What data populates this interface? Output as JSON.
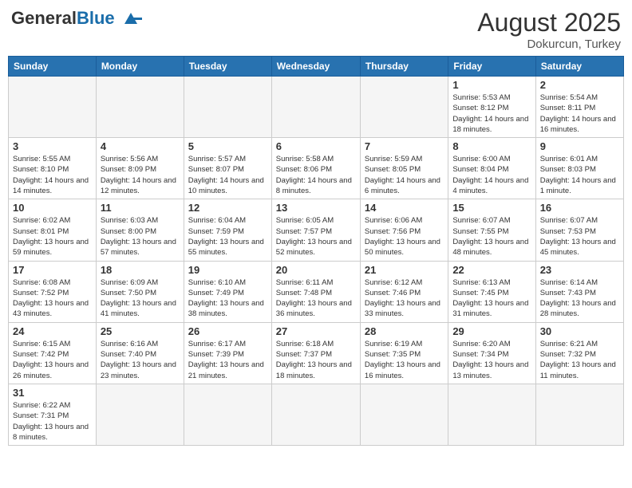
{
  "header": {
    "logo_general": "General",
    "logo_blue": "Blue",
    "month_year": "August 2025",
    "location": "Dokurcun, Turkey"
  },
  "weekdays": [
    "Sunday",
    "Monday",
    "Tuesday",
    "Wednesday",
    "Thursday",
    "Friday",
    "Saturday"
  ],
  "weeks": [
    [
      {
        "day": "",
        "info": ""
      },
      {
        "day": "",
        "info": ""
      },
      {
        "day": "",
        "info": ""
      },
      {
        "day": "",
        "info": ""
      },
      {
        "day": "",
        "info": ""
      },
      {
        "day": "1",
        "info": "Sunrise: 5:53 AM\nSunset: 8:12 PM\nDaylight: 14 hours and 18 minutes."
      },
      {
        "day": "2",
        "info": "Sunrise: 5:54 AM\nSunset: 8:11 PM\nDaylight: 14 hours and 16 minutes."
      }
    ],
    [
      {
        "day": "3",
        "info": "Sunrise: 5:55 AM\nSunset: 8:10 PM\nDaylight: 14 hours and 14 minutes."
      },
      {
        "day": "4",
        "info": "Sunrise: 5:56 AM\nSunset: 8:09 PM\nDaylight: 14 hours and 12 minutes."
      },
      {
        "day": "5",
        "info": "Sunrise: 5:57 AM\nSunset: 8:07 PM\nDaylight: 14 hours and 10 minutes."
      },
      {
        "day": "6",
        "info": "Sunrise: 5:58 AM\nSunset: 8:06 PM\nDaylight: 14 hours and 8 minutes."
      },
      {
        "day": "7",
        "info": "Sunrise: 5:59 AM\nSunset: 8:05 PM\nDaylight: 14 hours and 6 minutes."
      },
      {
        "day": "8",
        "info": "Sunrise: 6:00 AM\nSunset: 8:04 PM\nDaylight: 14 hours and 4 minutes."
      },
      {
        "day": "9",
        "info": "Sunrise: 6:01 AM\nSunset: 8:03 PM\nDaylight: 14 hours and 1 minute."
      }
    ],
    [
      {
        "day": "10",
        "info": "Sunrise: 6:02 AM\nSunset: 8:01 PM\nDaylight: 13 hours and 59 minutes."
      },
      {
        "day": "11",
        "info": "Sunrise: 6:03 AM\nSunset: 8:00 PM\nDaylight: 13 hours and 57 minutes."
      },
      {
        "day": "12",
        "info": "Sunrise: 6:04 AM\nSunset: 7:59 PM\nDaylight: 13 hours and 55 minutes."
      },
      {
        "day": "13",
        "info": "Sunrise: 6:05 AM\nSunset: 7:57 PM\nDaylight: 13 hours and 52 minutes."
      },
      {
        "day": "14",
        "info": "Sunrise: 6:06 AM\nSunset: 7:56 PM\nDaylight: 13 hours and 50 minutes."
      },
      {
        "day": "15",
        "info": "Sunrise: 6:07 AM\nSunset: 7:55 PM\nDaylight: 13 hours and 48 minutes."
      },
      {
        "day": "16",
        "info": "Sunrise: 6:07 AM\nSunset: 7:53 PM\nDaylight: 13 hours and 45 minutes."
      }
    ],
    [
      {
        "day": "17",
        "info": "Sunrise: 6:08 AM\nSunset: 7:52 PM\nDaylight: 13 hours and 43 minutes."
      },
      {
        "day": "18",
        "info": "Sunrise: 6:09 AM\nSunset: 7:50 PM\nDaylight: 13 hours and 41 minutes."
      },
      {
        "day": "19",
        "info": "Sunrise: 6:10 AM\nSunset: 7:49 PM\nDaylight: 13 hours and 38 minutes."
      },
      {
        "day": "20",
        "info": "Sunrise: 6:11 AM\nSunset: 7:48 PM\nDaylight: 13 hours and 36 minutes."
      },
      {
        "day": "21",
        "info": "Sunrise: 6:12 AM\nSunset: 7:46 PM\nDaylight: 13 hours and 33 minutes."
      },
      {
        "day": "22",
        "info": "Sunrise: 6:13 AM\nSunset: 7:45 PM\nDaylight: 13 hours and 31 minutes."
      },
      {
        "day": "23",
        "info": "Sunrise: 6:14 AM\nSunset: 7:43 PM\nDaylight: 13 hours and 28 minutes."
      }
    ],
    [
      {
        "day": "24",
        "info": "Sunrise: 6:15 AM\nSunset: 7:42 PM\nDaylight: 13 hours and 26 minutes."
      },
      {
        "day": "25",
        "info": "Sunrise: 6:16 AM\nSunset: 7:40 PM\nDaylight: 13 hours and 23 minutes."
      },
      {
        "day": "26",
        "info": "Sunrise: 6:17 AM\nSunset: 7:39 PM\nDaylight: 13 hours and 21 minutes."
      },
      {
        "day": "27",
        "info": "Sunrise: 6:18 AM\nSunset: 7:37 PM\nDaylight: 13 hours and 18 minutes."
      },
      {
        "day": "28",
        "info": "Sunrise: 6:19 AM\nSunset: 7:35 PM\nDaylight: 13 hours and 16 minutes."
      },
      {
        "day": "29",
        "info": "Sunrise: 6:20 AM\nSunset: 7:34 PM\nDaylight: 13 hours and 13 minutes."
      },
      {
        "day": "30",
        "info": "Sunrise: 6:21 AM\nSunset: 7:32 PM\nDaylight: 13 hours and 11 minutes."
      }
    ],
    [
      {
        "day": "31",
        "info": "Sunrise: 6:22 AM\nSunset: 7:31 PM\nDaylight: 13 hours and 8 minutes."
      },
      {
        "day": "",
        "info": ""
      },
      {
        "day": "",
        "info": ""
      },
      {
        "day": "",
        "info": ""
      },
      {
        "day": "",
        "info": ""
      },
      {
        "day": "",
        "info": ""
      },
      {
        "day": "",
        "info": ""
      }
    ]
  ]
}
